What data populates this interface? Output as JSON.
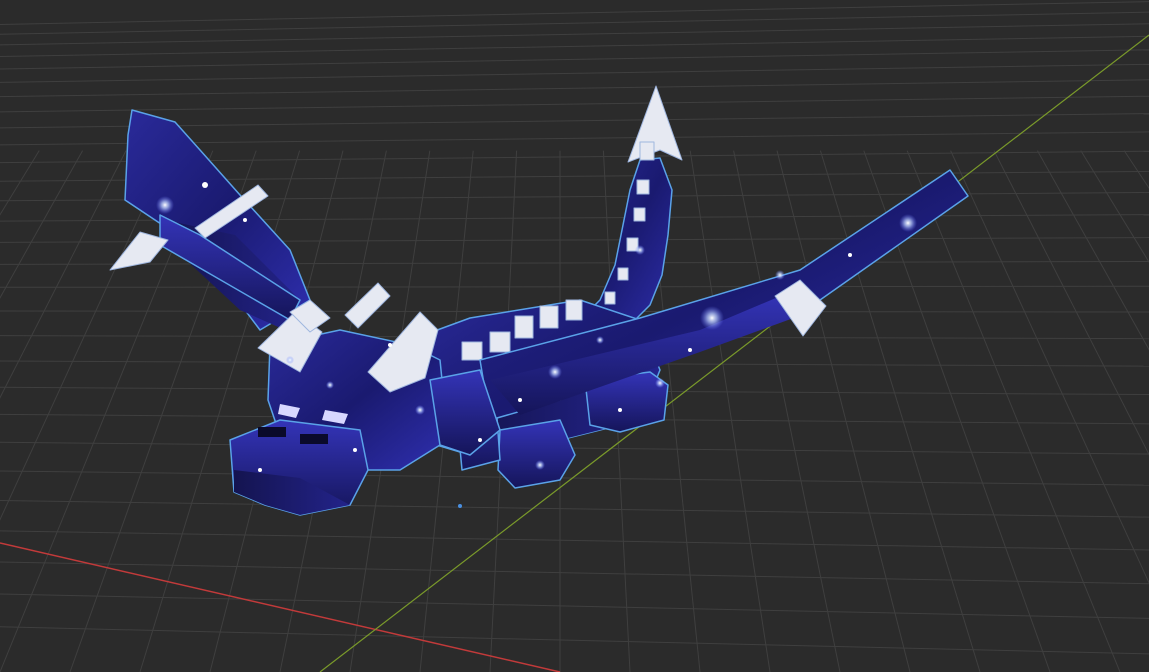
{
  "viewport": {
    "background": "#2b2b2b",
    "grid_color": "#3f3f3f",
    "x_axis_color": "#c23a3a",
    "y_axis_color": "#7a9a2a",
    "selection_outline_color": "#5aa2e8",
    "origin_marker_color": "#4a8fe0"
  },
  "model": {
    "subject": "ender-dragon",
    "texture": "galaxy",
    "body_color_dark": "#1b1b66",
    "body_color_light": "#3a3ab0",
    "spike_color": "#e6e9f2",
    "eye_color": "#d8d8ff",
    "selected": true
  }
}
